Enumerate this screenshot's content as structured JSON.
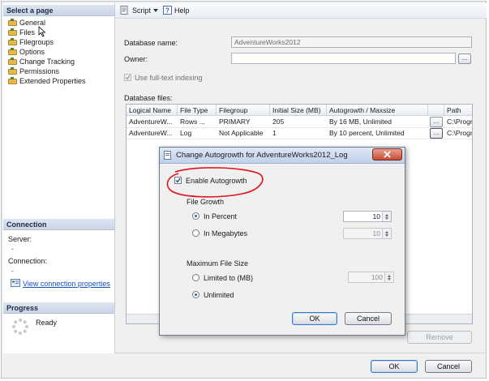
{
  "left_panel": {
    "select_page_header": "Select a page",
    "pages": [
      "General",
      "Files",
      "Filegroups",
      "Options",
      "Change Tracking",
      "Permissions",
      "Extended Properties"
    ],
    "connection_header": "Connection",
    "server_label": "Server:",
    "server_value": "-",
    "connection_label": "Connection:",
    "connection_value": "-",
    "view_connection_link": "View connection properties",
    "progress_header": "Progress",
    "progress_status": "Ready"
  },
  "toolbar": {
    "script_label": "Script",
    "help_label": "Help"
  },
  "form": {
    "database_name_label": "Database name:",
    "database_name_value": "AdventureWorks2012",
    "owner_label": "Owner:",
    "owner_value": "",
    "browse_label": "...",
    "fulltext_label": "Use full-text indexing",
    "database_files_label": "Database files:"
  },
  "files_table": {
    "columns": [
      "Logical Name",
      "File Type",
      "Filegroup",
      "Initial Size (MB)",
      "Autogrowth / Maxsize",
      "",
      "Path"
    ],
    "rows": [
      {
        "logical_name": "AdventureW...",
        "file_type": "Rows ...",
        "filegroup": "PRIMARY",
        "initial_size": "205",
        "autogrowth": "By 16 MB, Unlimited",
        "browse": "...",
        "path": "C:\\Progr"
      },
      {
        "logical_name": "AdventureW...",
        "file_type": "Log",
        "filegroup": "Not Applicable",
        "initial_size": "1",
        "autogrowth": "By 10 percent, Unlimited",
        "browse": "...",
        "path": "C:\\Progr"
      }
    ]
  },
  "remove_button": "Remove",
  "footer": {
    "ok_label": "OK",
    "cancel_label": "Cancel"
  },
  "dialog": {
    "title": "Change Autogrowth for AdventureWorks2012_Log",
    "enable_autogrowth_label": "Enable Autogrowth",
    "file_growth_label": "File Growth",
    "in_percent_label": "In Percent",
    "in_percent_value": "10",
    "in_megabytes_label": "In Megabytes",
    "in_megabytes_value": "10",
    "max_file_size_label": "Maximum File Size",
    "limited_label": "Limited to (MB)",
    "limited_value": "100",
    "unlimited_label": "Unlimited",
    "ok_label": "OK",
    "cancel_label": "Cancel"
  },
  "colors": {
    "annotation_red": "#e0121b",
    "header_blue": "#c9d4e6",
    "link_blue": "#1a4fb8"
  }
}
